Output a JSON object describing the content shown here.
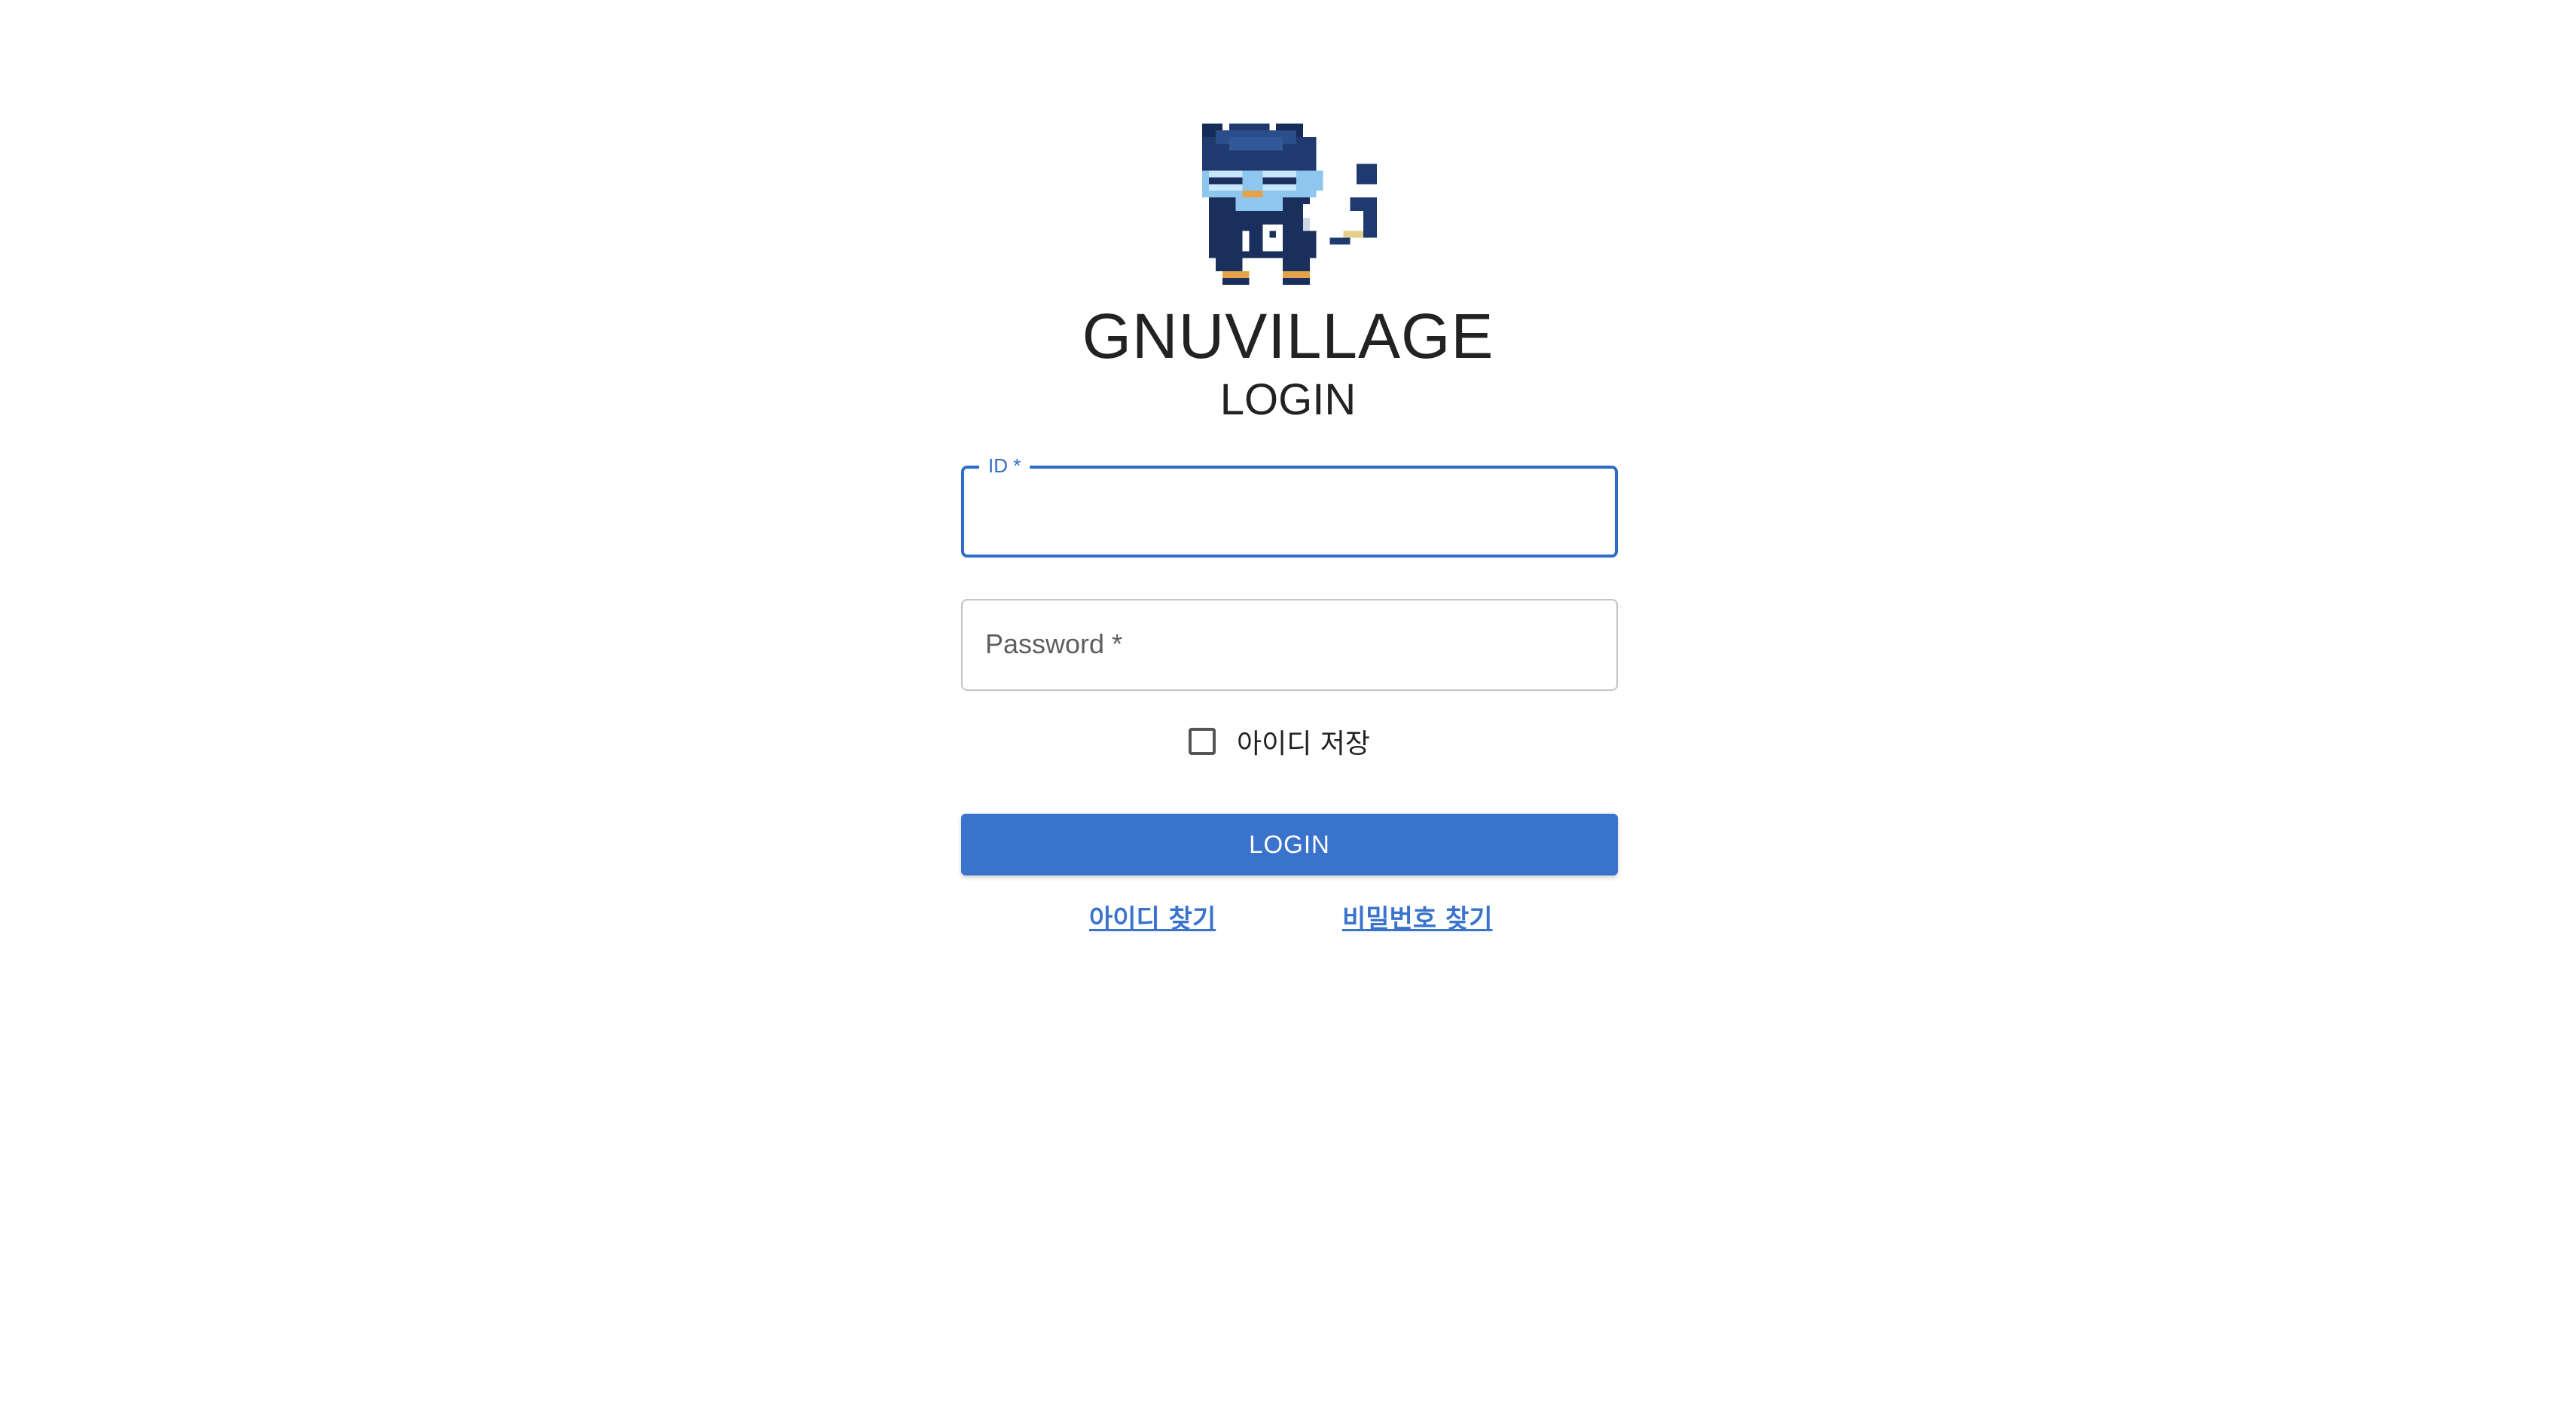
{
  "brand": {
    "logo": "gnuvillage-pixel-mascot",
    "title": "GNUVILLAGE"
  },
  "page_title": "LOGIN",
  "form": {
    "id_field": {
      "label": "ID *",
      "value": ""
    },
    "password_field": {
      "label": "Password *",
      "value": ""
    },
    "remember": {
      "label": "아이디 저장",
      "checked": false
    },
    "submit_label": "LOGIN"
  },
  "links": {
    "find_id": "아이디 찾기",
    "find_password": "비밀번호 찾기"
  },
  "colors": {
    "primary": "#3a73cb",
    "focus_border": "#2f6ec6",
    "text": "#222222",
    "mascot_navy": "#1f3a6e",
    "mascot_light_blue": "#8ec6ee"
  }
}
